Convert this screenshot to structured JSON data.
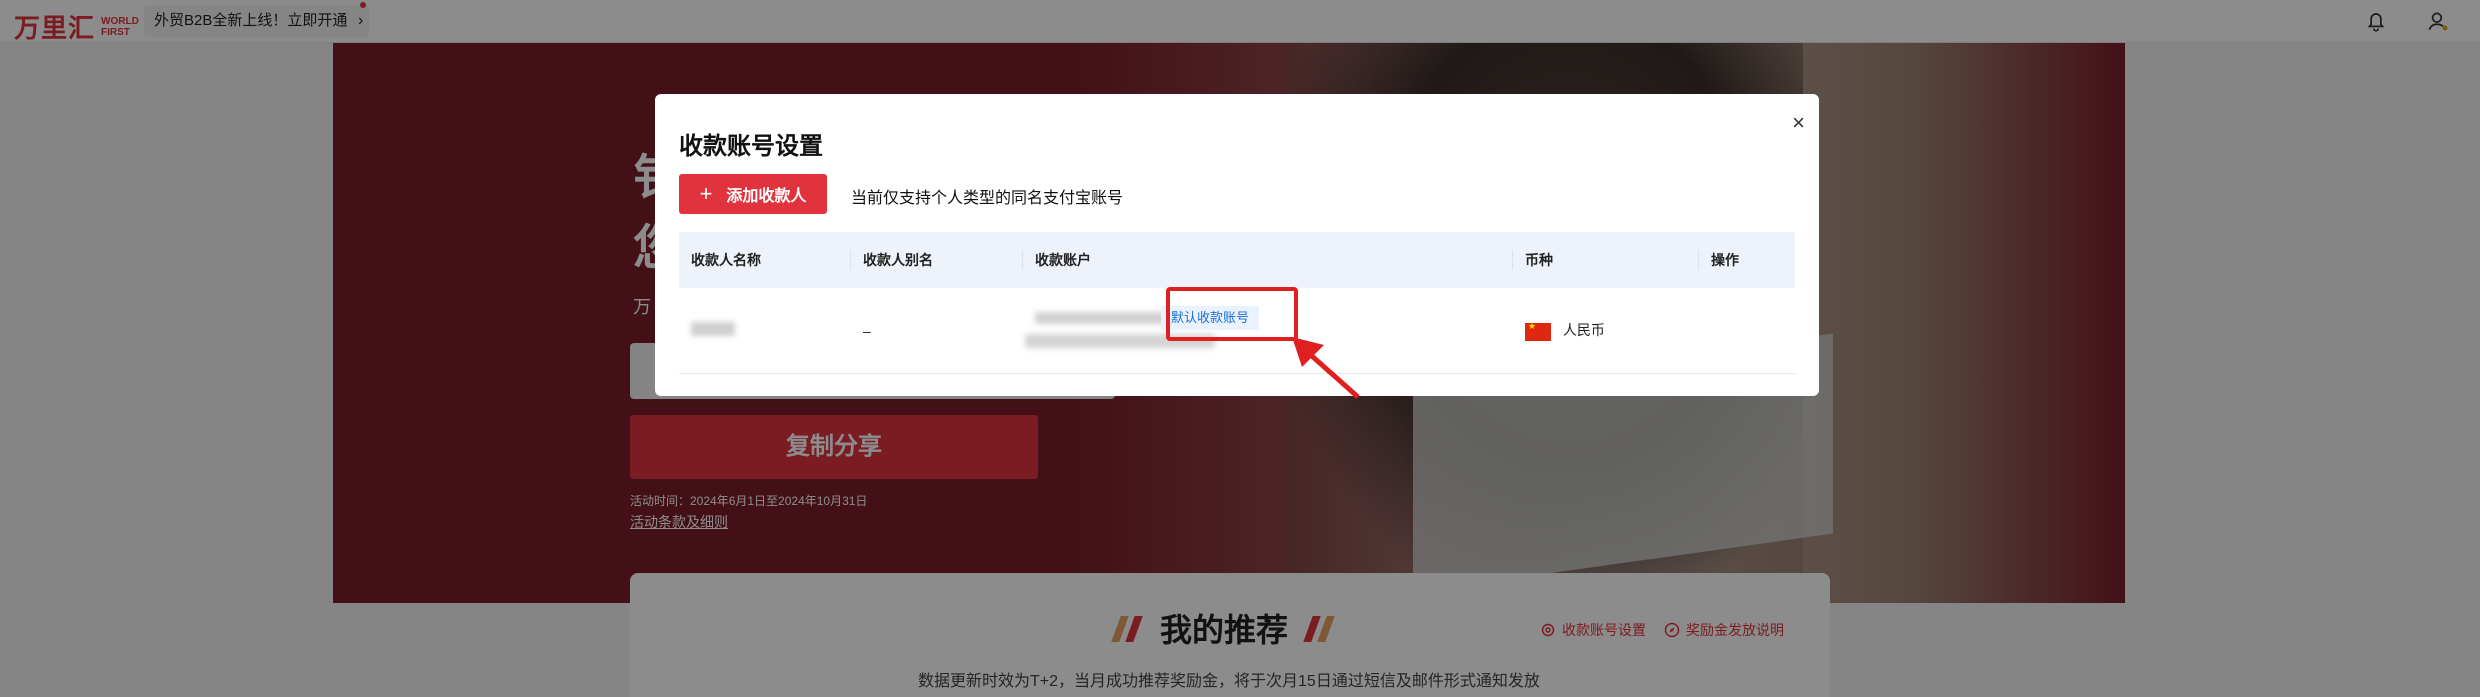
{
  "topbar": {
    "logo_cn": "万里汇",
    "logo_en_line1": "WORLD",
    "logo_en_line2": "FIRST",
    "promo_text": "外贸B2B全新上线！立即开通",
    "promo_chevron": "›"
  },
  "hero": {
    "headline_1": "钅",
    "headline_2": "您",
    "subtitle": "万",
    "share_button": "复制分享",
    "activity_time": "活动时间：2024年6月1日至2024年10月31日",
    "activity_rules": "活动条款及细则"
  },
  "recommend": {
    "title": "我的推荐",
    "link_account_settings": "收款账号设置",
    "link_reward_info": "奖励金发放说明",
    "note": "数据更新时效为T+2，当月成功推荐奖励金，将于次月15日通过短信及邮件形式通知发放"
  },
  "modal": {
    "title": "收款账号设置",
    "close_symbol": "×",
    "add_button": "添加收款人",
    "support_note": "当前仅支持个人类型的同名支付宝账号",
    "table": {
      "headers": [
        "收款人名称",
        "收款人别名",
        "收款账户",
        "币种",
        "操作"
      ],
      "rows": [
        {
          "alias": "–",
          "default_tag": "默认收款账号",
          "currency": "人民币"
        }
      ]
    }
  },
  "colors": {
    "brand_red": "#e0333e",
    "hero_bg": "#7a1e2b",
    "table_header_bg": "#eef2fb",
    "default_tag_text": "#1a6fd8",
    "annotation_red": "#e02020"
  },
  "icons": {
    "bell": "bell-icon",
    "user": "user-icon",
    "plus": "plus-icon",
    "settings": "settings-icon",
    "compass": "compass-icon",
    "flag": "china-flag-icon",
    "close": "close-icon"
  }
}
